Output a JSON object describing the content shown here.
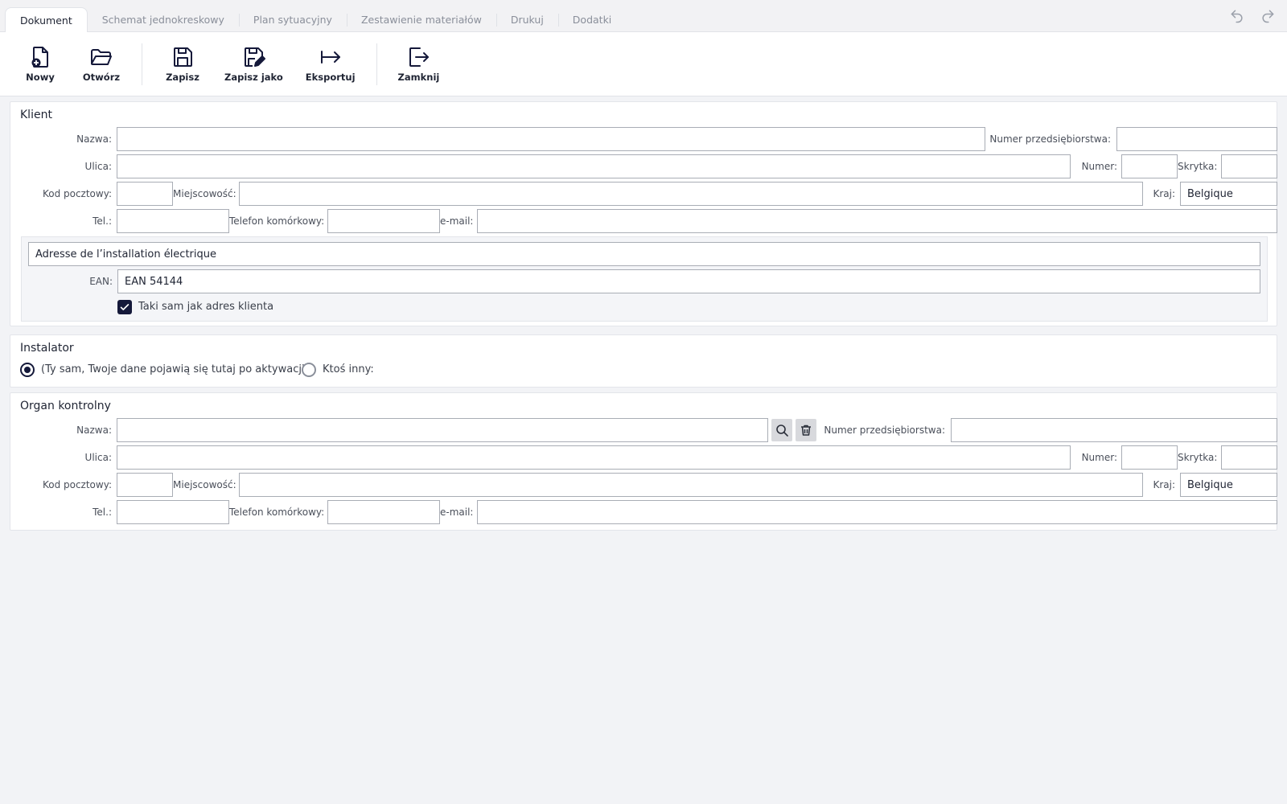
{
  "tabs": [
    {
      "label": "Dokument",
      "active": true
    },
    {
      "label": "Schemat jednokreskowy"
    },
    {
      "label": "Plan sytuacyjny"
    },
    {
      "label": "Zestawienie materiałów"
    },
    {
      "label": "Drukuj"
    },
    {
      "label": "Dodatki"
    }
  ],
  "toolbar": {
    "new": "Nowy",
    "open": "Otwórz",
    "save": "Zapisz",
    "save_as": "Zapisz jako",
    "export": "Eksportuj",
    "close": "Zamknij"
  },
  "klient": {
    "title": "Klient",
    "labels": {
      "name": "Nazwa:",
      "company_number": "Numer przedsiębiorstwa:",
      "street": "Ulica:",
      "number": "Numer:",
      "box": "Skrytka:",
      "postal": "Kod pocztowy:",
      "city": "Miejscowość:",
      "country": "Kraj:",
      "tel": "Tel.:",
      "mobile": "Telefon komórkowy:",
      "email": "e-mail:"
    },
    "values": {
      "name": "",
      "company_number": "",
      "street": "",
      "number": "",
      "box": "",
      "postal": "",
      "city": "",
      "country": "Belgique",
      "tel": "",
      "mobile": "",
      "email": ""
    },
    "installation": {
      "address_title": "Adresse de l’installation électrique",
      "ean_label": "EAN:",
      "ean_value": "EAN 54144",
      "same_as_client_label": "Taki sam jak adres klienta",
      "same_as_client_checked": true
    }
  },
  "instalator": {
    "title": "Instalator",
    "option_self": "(Ty sam, Twoje dane pojawią się tutaj po aktywacji)",
    "option_other": "Ktoś inny:",
    "selected": "self"
  },
  "organ": {
    "title": "Organ kontrolny",
    "labels": {
      "name": "Nazwa:",
      "company_number": "Numer przedsiębiorstwa:",
      "street": "Ulica:",
      "number": "Numer:",
      "box": "Skrytka:",
      "postal": "Kod pocztowy:",
      "city": "Miejscowość:",
      "country": "Kraj:",
      "tel": "Tel.:",
      "mobile": "Telefon komórkowy:",
      "email": "e-mail:"
    },
    "values": {
      "name": "",
      "company_number": "",
      "street": "",
      "number": "",
      "box": "",
      "postal": "",
      "city": "",
      "country": "Belgique",
      "tel": "",
      "mobile": "",
      "email": ""
    }
  },
  "colors": {
    "accent": "#15193a",
    "background": "#f2f3f6",
    "panel": "#ffffff"
  }
}
